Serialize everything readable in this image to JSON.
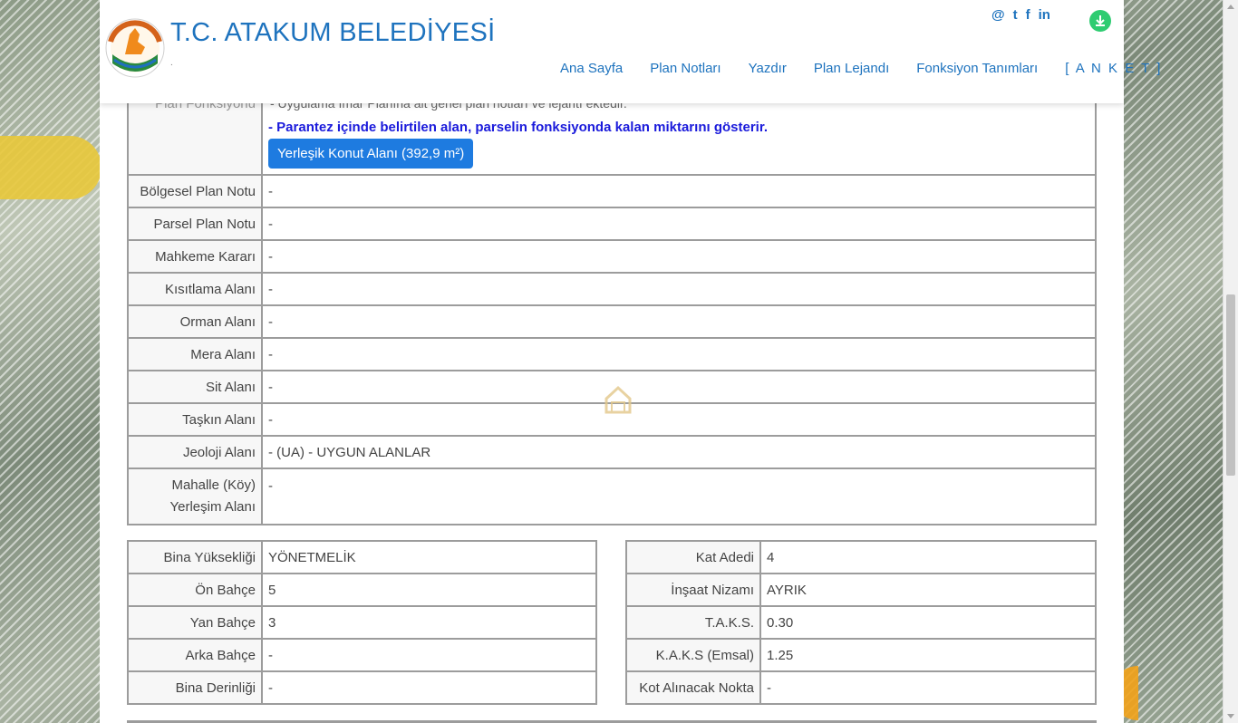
{
  "header": {
    "brand_title": "T.C. ATAKUM BELEDİYESİ",
    "brand_sub": ".",
    "logo_text": "ATAKUM BELEDİYESİ",
    "social": {
      "email": "@",
      "twitter": "t",
      "facebook": "f",
      "linkedin": "in"
    },
    "nav": [
      "Ana Sayfa",
      "Plan Notları",
      "Yazdır",
      "Plan Lejandı",
      "Fonksiyon Tanımları",
      "[ A N K E T ]"
    ]
  },
  "plan_section": {
    "label": "Plan Fonksiyonu",
    "faded_text": "- Uygulama İmar Planına ait genel plan notları ve lejantı ektedir.",
    "note": "- Parantez içinde belirtilen alan, parselin fonksiyonda kalan miktarını gösterir.",
    "pill": "Yerleşik Konut Alanı (392,9 m²)"
  },
  "rows": [
    {
      "key": "Bölgesel Plan Notu",
      "value": "-"
    },
    {
      "key": "Parsel Plan Notu",
      "value": "-"
    },
    {
      "key": "Mahkeme Kararı",
      "value": "-"
    },
    {
      "key": "Kısıtlama Alanı",
      "value": "-"
    },
    {
      "key": "Orman Alanı",
      "value": "-"
    },
    {
      "key": "Mera Alanı",
      "value": "-"
    },
    {
      "key": "Sit Alanı",
      "value": "-"
    },
    {
      "key": "Taşkın Alanı",
      "value": "-"
    },
    {
      "key": "Jeoloji Alanı",
      "value": "- (UA) - UYGUN ALANLAR"
    }
  ],
  "mahalle": {
    "key_line1": "Mahalle (Köy)",
    "key_line2": "Yerleşim Alanı",
    "value": "-"
  },
  "left_table": [
    {
      "key": "Bina Yüksekliği",
      "value": "YÖNETMELİK"
    },
    {
      "key": "Ön Bahçe",
      "value": "5"
    },
    {
      "key": "Yan Bahçe",
      "value": "3"
    },
    {
      "key": "Arka Bahçe",
      "value": "-"
    },
    {
      "key": "Bina Derinliği",
      "value": "-"
    }
  ],
  "right_table": [
    {
      "key": "Kat Adedi",
      "value": "4"
    },
    {
      "key": "İnşaat Nizamı",
      "value": "AYRIK"
    },
    {
      "key": "T.A.K.S.",
      "value": "0.30"
    },
    {
      "key": "K.A.K.S (Emsal)",
      "value": "1.25"
    },
    {
      "key": "Kot Alınacak Nokta",
      "value": "-"
    }
  ],
  "colors": {
    "brand": "#1e73be",
    "pill": "#1e7be0",
    "note": "#1a1adb",
    "border": "#9c9c9c"
  }
}
